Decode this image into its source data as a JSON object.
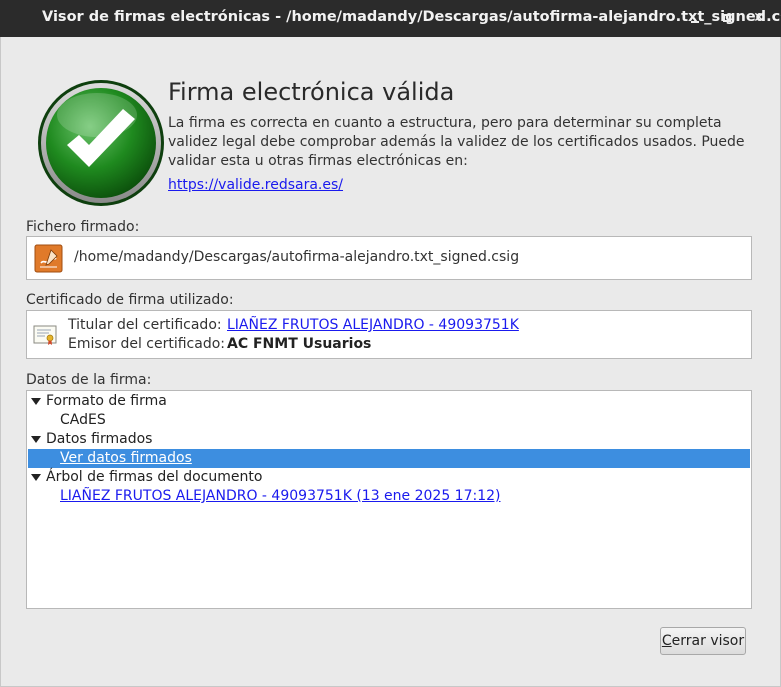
{
  "window": {
    "title": "Visor de firmas electrónicas - /home/madandy/Descargas/autofirma-alejandro.txt_signed.csig"
  },
  "status": {
    "icon": "valid-check-icon",
    "heading": "Firma electrónica válida",
    "description": "La firma es correcta en cuanto a estructura, pero para determinar su completa validez legal debe comprobar además la validez de los certificados usados. Puede validar esta u otras firmas electrónicas en:",
    "link": "https://valide.redsara.es/"
  },
  "signed_file": {
    "label": "Fichero firmado:",
    "icon": "signed-file-icon",
    "path": "/home/madandy/Descargas/autofirma-alejandro.txt_signed.csig"
  },
  "certificate": {
    "label": "Certificado de firma utilizado:",
    "icon": "certificate-icon",
    "holder_label": "Titular del certificado:",
    "holder_value": "LIAÑEZ FRUTOS ALEJANDRO - 49093751K",
    "issuer_label": "Emisor del certificado:",
    "issuer_value": "AC FNMT Usuarios"
  },
  "signature_data": {
    "label": "Datos de la firma:",
    "tree": {
      "format_node": "Formato de firma",
      "format_value": "CAdES",
      "signed_data_node": "Datos firmados",
      "signed_data_link": "Ver datos firmados",
      "signature_tree_node": "Árbol de firmas del documento",
      "signer": "LIAÑEZ FRUTOS ALEJANDRO - 49093751K (13 ene 2025 17:12)"
    }
  },
  "buttons": {
    "close_mnemonic": "C",
    "close_rest": "errar visor"
  },
  "colors": {
    "selection": "#3d8ee0",
    "link": "#1a1aee",
    "titlebar": "#2b2b2b",
    "check_green": "#2e8b2e"
  }
}
